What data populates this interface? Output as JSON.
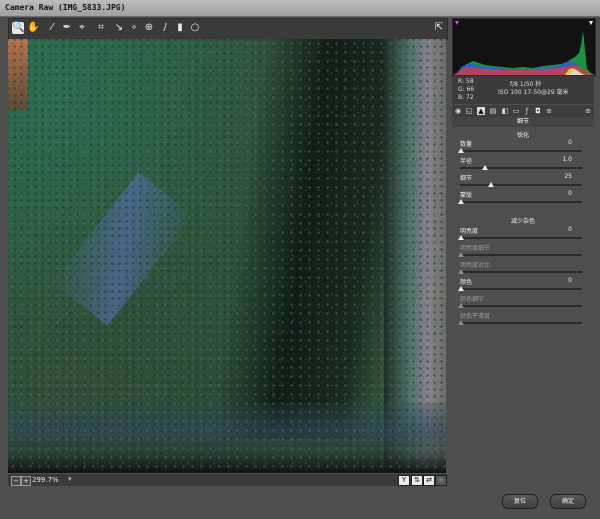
{
  "window": {
    "title": "Camera Raw (IMG_5833.JPG)"
  },
  "toolbar": {
    "tools": [
      {
        "name": "zoom-tool",
        "icon": "🔍"
      },
      {
        "name": "hand-tool",
        "icon": "✋"
      },
      {
        "name": "white-balance-tool",
        "icon": "⁄"
      },
      {
        "name": "color-sampler-tool",
        "icon": "✒"
      },
      {
        "name": "targeted-adjust-tool",
        "icon": "⌖"
      },
      {
        "name": "crop-tool",
        "icon": "⌗"
      },
      {
        "name": "straighten-tool",
        "icon": "↘"
      },
      {
        "name": "red-eye-tool",
        "icon": "∘"
      },
      {
        "name": "spot-removal-tool",
        "icon": "⊕"
      },
      {
        "name": "adjustment-brush-tool",
        "icon": "/"
      },
      {
        "name": "graduated-filter-tool",
        "icon": "▮"
      },
      {
        "name": "radial-filter-tool",
        "icon": "○"
      }
    ],
    "open_preferences_icon": "⇱"
  },
  "readout": {
    "r": "R:  58",
    "g": "G:  66",
    "b": "B:  72",
    "aperture_shutter": "f/8   1/50 秒",
    "iso_lens": "ISO 100   17-50@29 毫米"
  },
  "panel": {
    "title": "细节",
    "sharpening": {
      "title": "锐化",
      "amount": {
        "label": "数量",
        "value": "0"
      },
      "radius": {
        "label": "半径",
        "value": "1.0"
      },
      "detail": {
        "label": "细节",
        "value": "25"
      },
      "masking": {
        "label": "蒙版",
        "value": "0"
      }
    },
    "noise_reduction": {
      "title": "减少杂色",
      "luminance": {
        "label": "明亮度",
        "value": "0"
      },
      "luminance_detail": {
        "label": "明亮度细节"
      },
      "luminance_contrast": {
        "label": "明亮度对比"
      },
      "color": {
        "label": "颜色",
        "value": "0"
      },
      "color_detail": {
        "label": "颜色细节"
      },
      "color_smoothness": {
        "label": "颜色平滑度"
      }
    }
  },
  "statusbar": {
    "zoom_value": "299.7%",
    "zoom_out": "−",
    "zoom_in": "+",
    "before_after_toggle": "Y"
  },
  "footer": {
    "reset_label": "复位",
    "ok_label": "确定"
  },
  "histogram": {
    "shadow_clip_color": "#ff33ff",
    "highlight_clip_color": "#ffffff"
  }
}
